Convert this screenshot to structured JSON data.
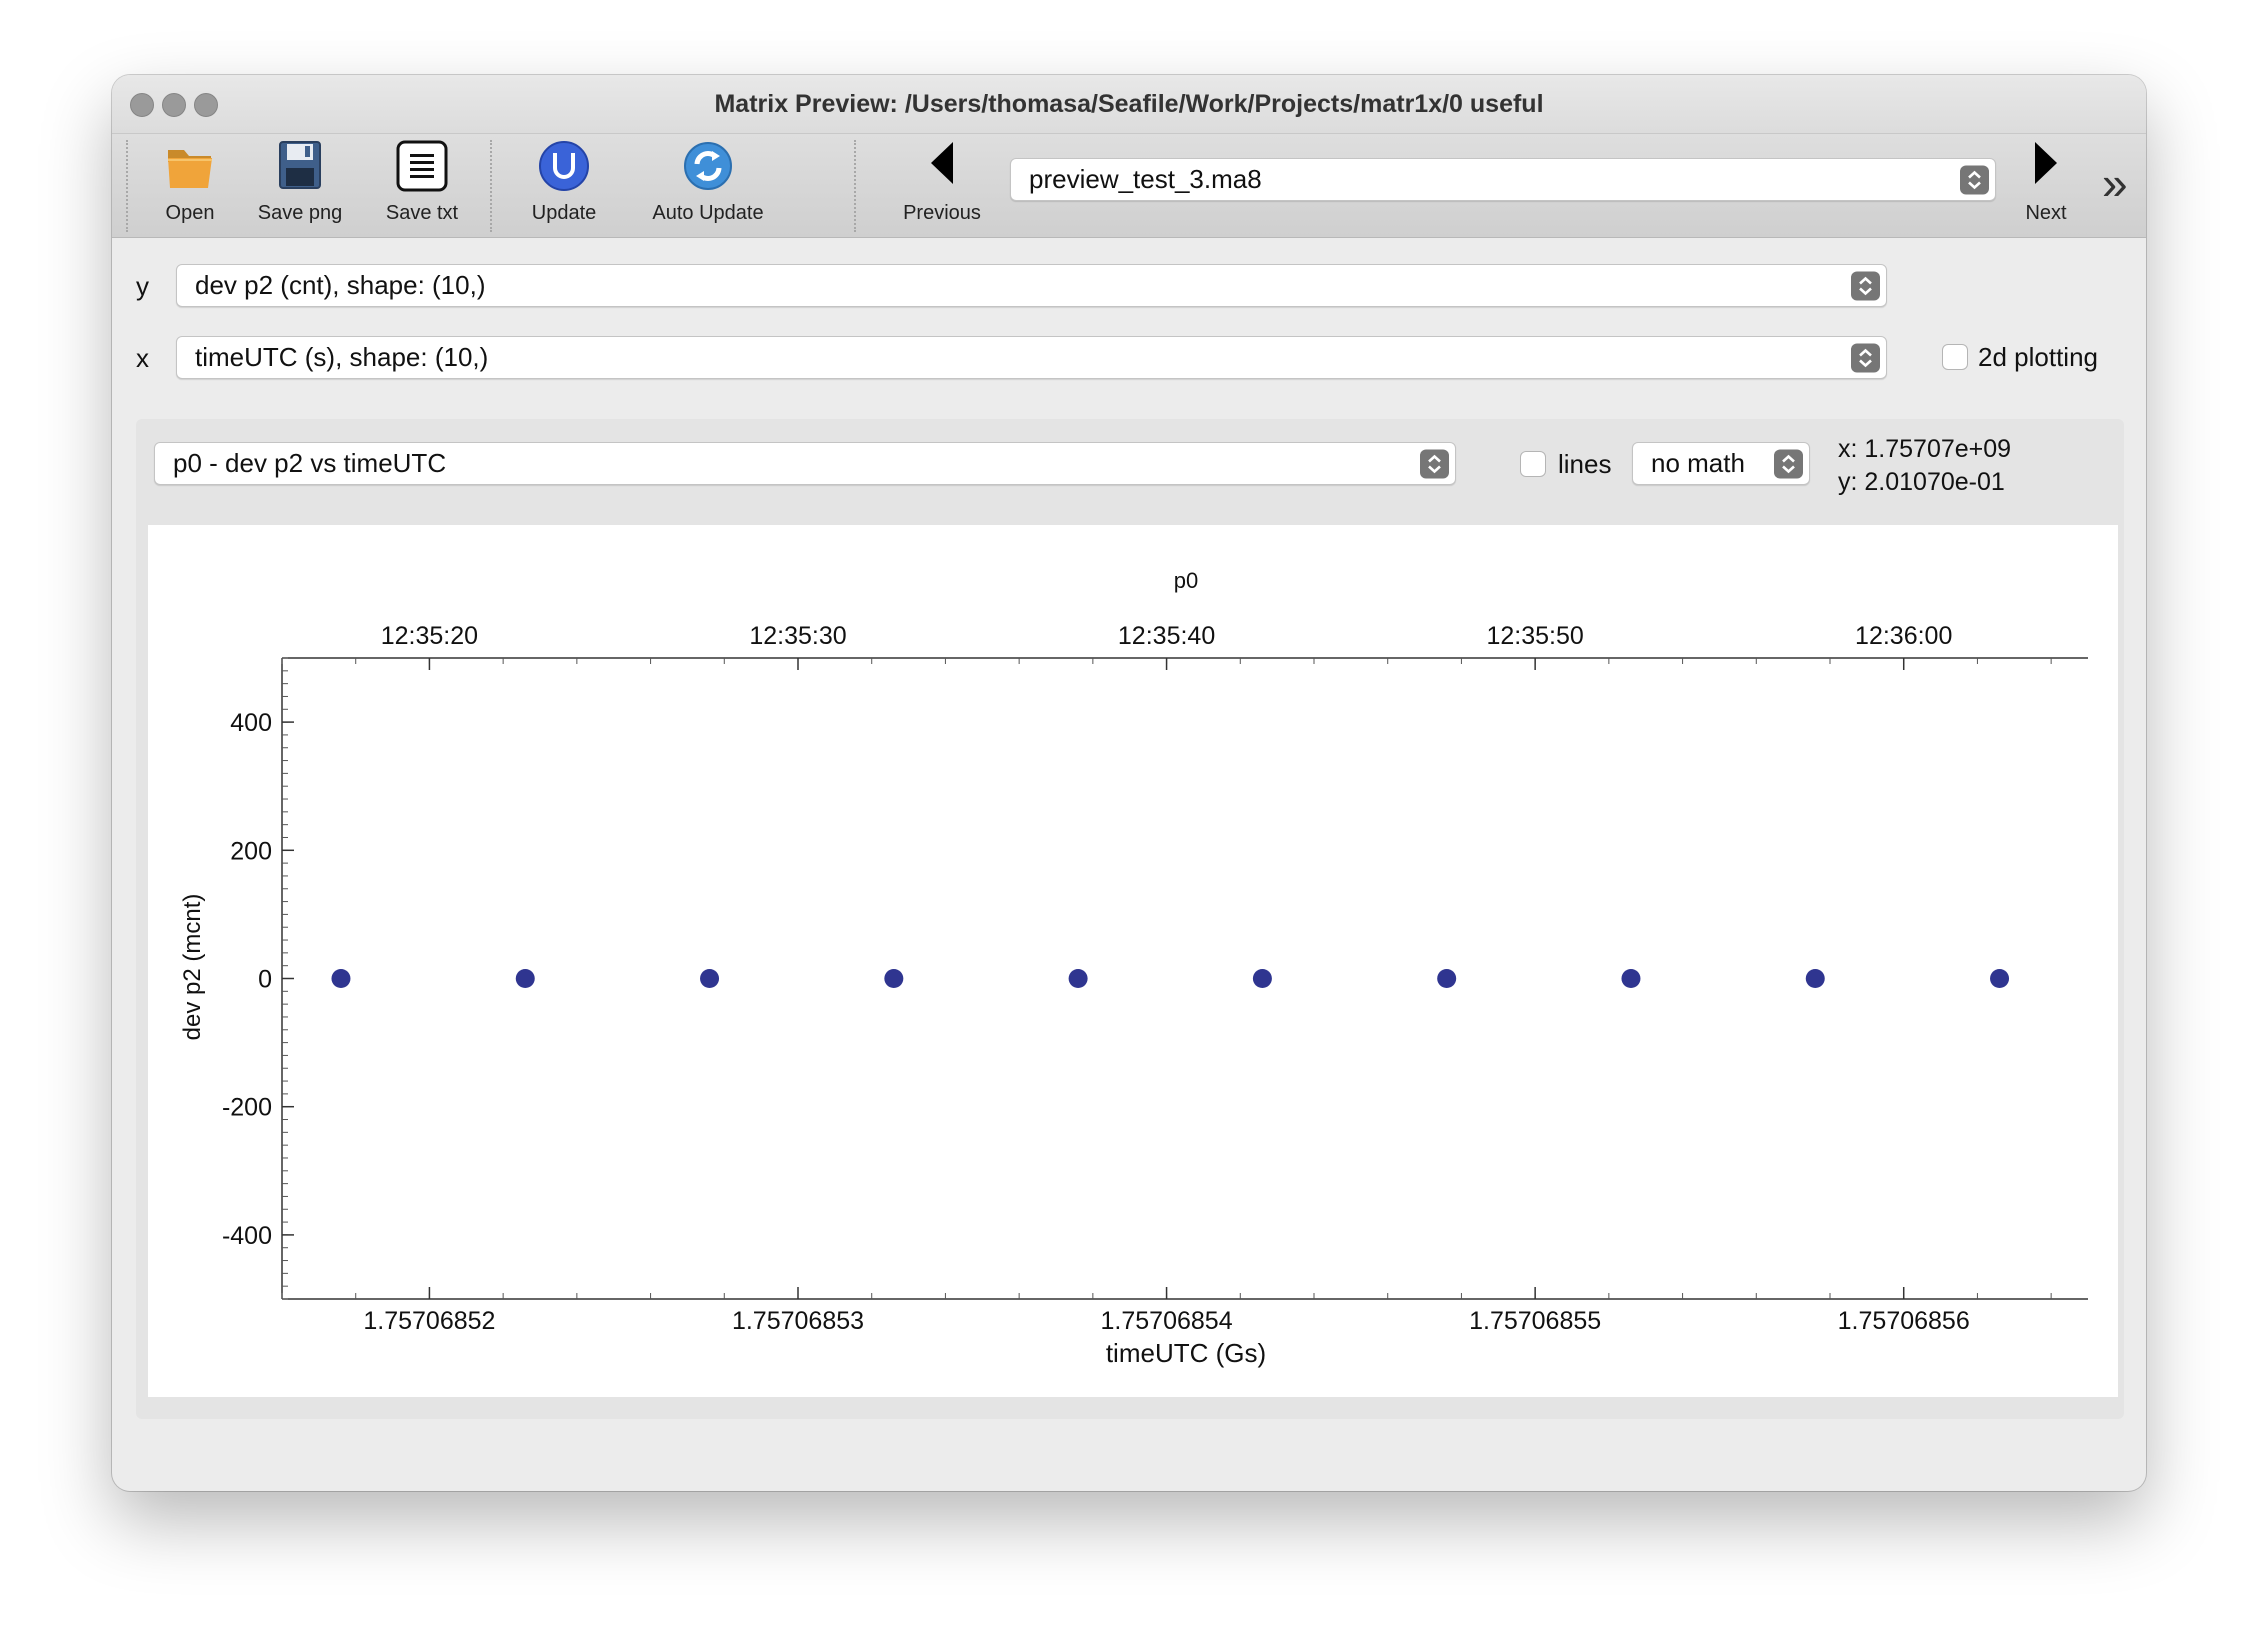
{
  "window": {
    "title": "Matrix Preview: /Users/thomasa/Seafile/Work/Projects/matr1x/0 useful"
  },
  "toolbar": {
    "open_label": "Open",
    "save_png_label": "Save png",
    "save_txt_label": "Save txt",
    "update_label": "Update",
    "auto_update_label": "Auto Update",
    "previous_label": "Previous",
    "next_label": "Next",
    "file_select_value": "preview_test_3.ma8",
    "overflow_glyph": "»"
  },
  "axis_select": {
    "y_label": "y",
    "y_value": "dev p2 (cnt), shape: (10,)",
    "x_label": "x",
    "x_value": "timeUTC (s), shape: (10,)",
    "twod_label": "2d plotting"
  },
  "plot_controls": {
    "plot_select_value": "p0 - dev p2 vs timeUTC",
    "lines_label": "lines",
    "math_value": "no math",
    "cursor_x": "x: 1.75707e+09",
    "cursor_y": "y: 2.01070e-01"
  },
  "colors": {
    "marker": "#2f3590",
    "update_icon": "#3a63d8",
    "auto_update_icon": "#3f8fd8"
  },
  "icons": {
    "open": "folder-icon",
    "save_png": "floppy-disk-icon",
    "save_txt": "text-document-icon",
    "update": "update-u-icon",
    "auto_update": "refresh-icon",
    "previous": "triangle-left-icon",
    "next": "triangle-right-icon"
  },
  "chart_data": {
    "type": "scatter",
    "title": "p0",
    "xlabel": "timeUTC (Gs)",
    "ylabel": "dev p2 (mcnt)",
    "xlim": [
      1.757068516,
      1.757068565
    ],
    "ylim": [
      -500,
      500
    ],
    "x_ticks": [
      1.75706852,
      1.75706853,
      1.75706854,
      1.75706855,
      1.75706856
    ],
    "x_tick_labels": [
      "1.75706852",
      "1.75706853",
      "1.75706854",
      "1.75706855",
      "1.75706856"
    ],
    "top_ticks": [
      1.75706852,
      1.75706853,
      1.75706854,
      1.75706855,
      1.75706856
    ],
    "top_tick_labels": [
      "12:35:20",
      "12:35:30",
      "12:35:40",
      "12:35:50",
      "12:36:00"
    ],
    "y_ticks": [
      -400,
      -200,
      0,
      200,
      400
    ],
    "y_tick_labels": [
      "-400",
      "-200",
      "0",
      "200",
      "400"
    ],
    "grid": false,
    "legend": false,
    "series": [
      {
        "x": [
          1.7570685176,
          1.7570685226,
          1.7570685276,
          1.7570685326,
          1.7570685376,
          1.7570685426,
          1.7570685476,
          1.7570685526,
          1.7570685576,
          1.7570685626
        ],
        "y": [
          0,
          0,
          0,
          0,
          0,
          0,
          0,
          0,
          0,
          0
        ],
        "color": "#2f3590"
      }
    ]
  }
}
